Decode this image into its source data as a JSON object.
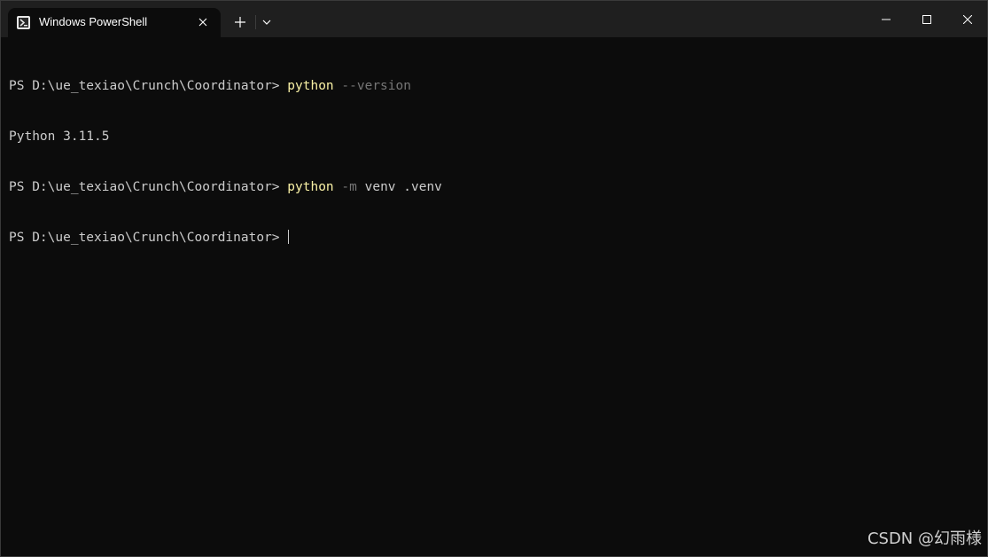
{
  "window": {
    "tab_title": "Windows PowerShell",
    "icons": {
      "tab_icon": "powershell-icon",
      "close_tab": "close-icon",
      "new_tab": "plus-icon",
      "dropdown": "chevron-down-icon",
      "minimize": "minimize-icon",
      "maximize": "maximize-icon",
      "close_window": "close-icon"
    }
  },
  "terminal": {
    "lines": [
      {
        "prompt": "PS D:\\ue_texiao\\Crunch\\Coordinator> ",
        "command": "python",
        "param": "--version",
        "args": ""
      },
      {
        "output": "Python 3.11.5"
      },
      {
        "prompt": "PS D:\\ue_texiao\\Crunch\\Coordinator> ",
        "command": "python",
        "param": "-m",
        "args": " venv .venv"
      },
      {
        "prompt": "PS D:\\ue_texiao\\Crunch\\Coordinator> ",
        "command": "",
        "param": "",
        "args": ""
      }
    ],
    "colors": {
      "background": "#0c0c0c",
      "text": "#cccccc",
      "command": "#f9f1a5",
      "parameter": "#767676"
    }
  },
  "watermark": "CSDN @幻雨様"
}
